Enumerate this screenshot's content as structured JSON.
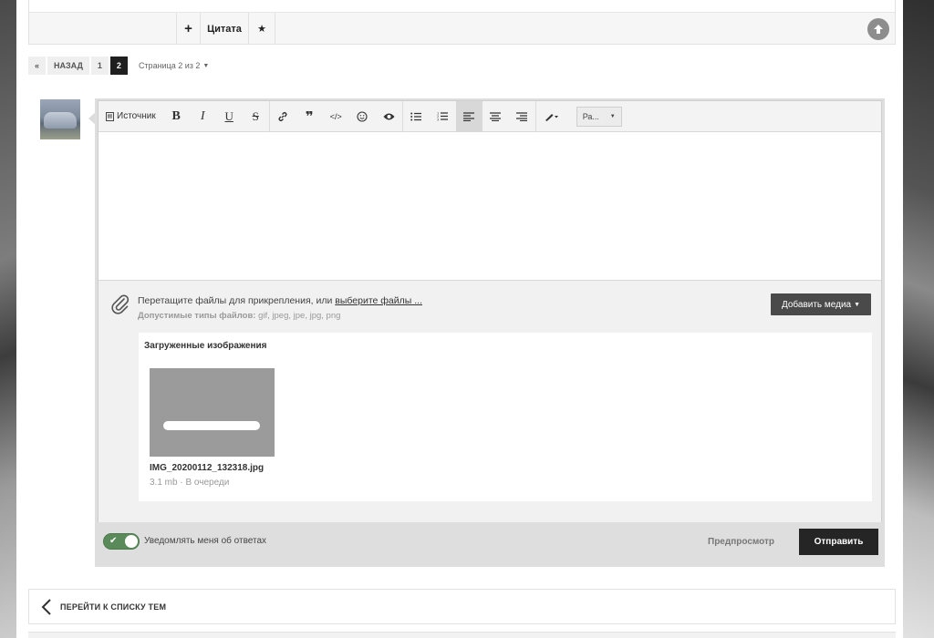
{
  "post_actions": {
    "plus_label": "+",
    "quote_label": "Цитата",
    "star_label": "★",
    "icons": {
      "scroll_top": "arrow-up-circle-icon"
    }
  },
  "pagination": {
    "prev_arrow": "«",
    "back_label": "НАЗАД",
    "pages": [
      "1",
      "2"
    ],
    "current_page": "2",
    "page_info": "Страница 2 из 2",
    "caret": "▼"
  },
  "editor": {
    "toolbar": {
      "source_label": "Источник",
      "bold": "B",
      "italic": "I",
      "underline": "U",
      "strike": "S",
      "font_select_value": "Ра...",
      "caret": "▼",
      "icons": [
        "source-icon",
        "bold-icon",
        "italic-icon",
        "underline-icon",
        "strikethrough-icon",
        "link-icon",
        "quote-icon",
        "code-icon",
        "emoji-icon",
        "spoiler-eye-icon",
        "bullet-list-icon",
        "numbered-list-icon",
        "align-left-icon",
        "align-center-icon",
        "align-right-icon",
        "text-color-icon"
      ]
    },
    "attachments": {
      "drop_text": "Перетащите файлы для прикрепления, или ",
      "choose_link": "выберите файлы ...",
      "allowed_label": "Допустимые типы файлов:",
      "allowed_types": " gif, jpeg, jpe, jpg, png",
      "add_media_label": "Добавить медиа",
      "caret": "▼",
      "uploads_title": "Загруженные изображения",
      "files": [
        {
          "name": "IMG_20200112_132318.jpg",
          "meta": "3.1 mb · В очереди"
        }
      ]
    }
  },
  "footer": {
    "notify_label": "Уведомлять меня об ответах",
    "notify_on": true,
    "preview_label": "Предпросмотр",
    "submit_label": "Отправить"
  },
  "back_to_topics": {
    "label": "ПЕРЕЙТИ К СПИСКУ ТЕМ"
  },
  "colors": {
    "submit_bg": "#252525",
    "toggle_on": "#5a8a5a",
    "media_btn_bg": "#4a4a4a"
  }
}
